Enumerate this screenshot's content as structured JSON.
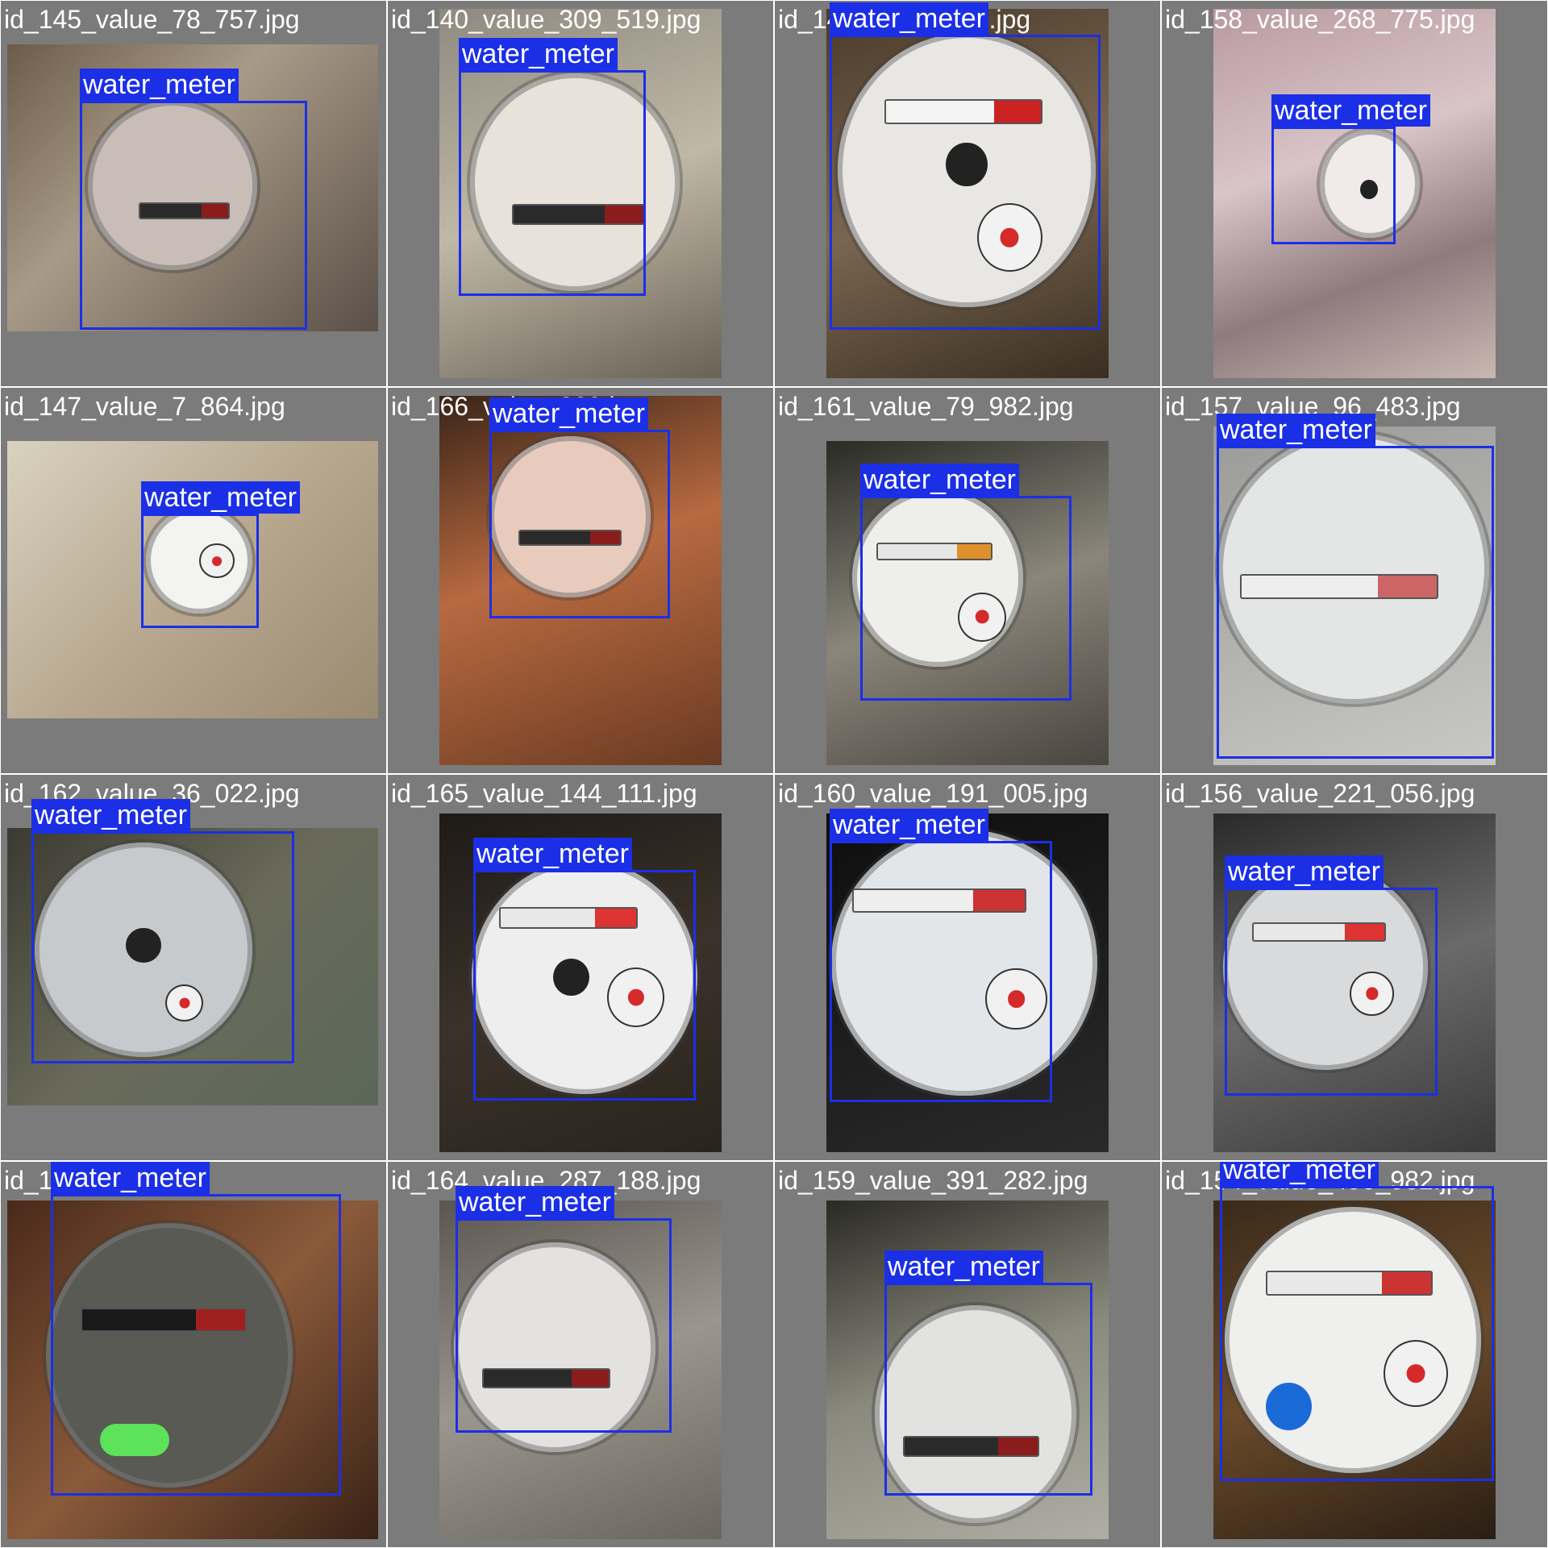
{
  "bbox_color": "#1b2fe6",
  "tiles": [
    {
      "filename": "id_145_value_78_757.jpg",
      "label": "water_meter"
    },
    {
      "filename": "id_140_value_309_519.jpg",
      "label": "water_meter"
    },
    {
      "filename": "id_141_value_337.jpg",
      "label": "water_meter"
    },
    {
      "filename": "id_158_value_268_775.jpg",
      "label": "water_meter"
    },
    {
      "filename": "id_147_value_7_864.jpg",
      "label": "water_meter"
    },
    {
      "filename": "id_166_value_329.jpg",
      "label": "water_meter"
    },
    {
      "filename": "id_161_value_79_982.jpg",
      "label": "water_meter"
    },
    {
      "filename": "id_157_value_96_483.jpg",
      "label": "water_meter"
    },
    {
      "filename": "id_162_value_36_022.jpg",
      "label": "water_meter"
    },
    {
      "filename": "id_165_value_144_111.jpg",
      "label": "water_meter"
    },
    {
      "filename": "id_160_value_191_005.jpg",
      "label": "water_meter"
    },
    {
      "filename": "id_156_value_221_056.jpg",
      "label": "water_meter"
    },
    {
      "filename": "id_141_39.jpg",
      "label": "water_meter"
    },
    {
      "filename": "id_164_value_287_188.jpg",
      "label": "water_meter"
    },
    {
      "filename": "id_159_value_391_282.jpg",
      "label": "water_meter"
    },
    {
      "filename": "id_154_value_498_982.jpg",
      "label": "water_meter"
    }
  ]
}
